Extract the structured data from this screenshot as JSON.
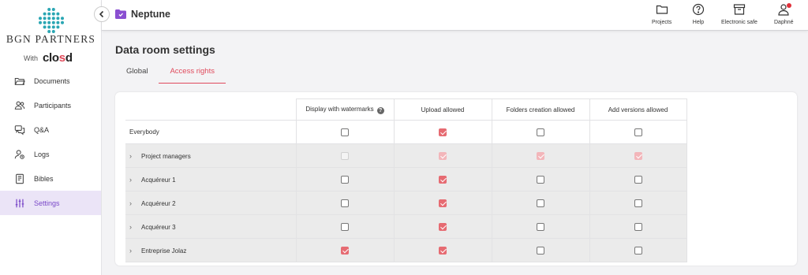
{
  "brand": {
    "name": "BGN PARTNERS",
    "with_label": "With",
    "partner_prefix": "clo",
    "partner_accent": "s",
    "partner_suffix": "d"
  },
  "sidebar": {
    "items": [
      {
        "label": "Documents",
        "icon": "folder-open-icon"
      },
      {
        "label": "Participants",
        "icon": "users-icon"
      },
      {
        "label": "Q&A",
        "icon": "chat-icon"
      },
      {
        "label": "Logs",
        "icon": "user-log-icon"
      },
      {
        "label": "Bibles",
        "icon": "book-icon"
      },
      {
        "label": "Settings",
        "icon": "sliders-icon",
        "active": true
      }
    ]
  },
  "header": {
    "project_title": "Neptune",
    "actions": [
      {
        "label": "Projects",
        "icon": "folder-icon"
      },
      {
        "label": "Help",
        "icon": "help-icon"
      },
      {
        "label": "Electronic safe",
        "icon": "archive-icon"
      },
      {
        "label": "Daphné",
        "icon": "user-icon",
        "notification": true
      }
    ]
  },
  "page": {
    "title": "Data room settings",
    "tabs": [
      {
        "label": "Global",
        "active": false
      },
      {
        "label": "Access rights",
        "active": true
      }
    ]
  },
  "permissions": {
    "columns": [
      "Display with watermarks",
      "Upload allowed",
      "Folders creation allowed",
      "Add versions allowed"
    ],
    "rows": [
      {
        "name": "Everybody",
        "expandable": false,
        "group": false,
        "disabled": false,
        "values": [
          false,
          true,
          false,
          false
        ]
      },
      {
        "name": "Project managers",
        "expandable": true,
        "group": true,
        "disabled": true,
        "values": [
          false,
          true,
          true,
          true
        ]
      },
      {
        "name": "Acquéreur 1",
        "expandable": true,
        "group": true,
        "disabled": false,
        "values": [
          false,
          true,
          false,
          false
        ]
      },
      {
        "name": "Acquéreur 2",
        "expandable": true,
        "group": true,
        "disabled": false,
        "values": [
          false,
          true,
          false,
          false
        ]
      },
      {
        "name": "Acquéreur 3",
        "expandable": true,
        "group": true,
        "disabled": false,
        "values": [
          false,
          true,
          false,
          false
        ]
      },
      {
        "name": "Entreprise Jolaz",
        "expandable": true,
        "group": true,
        "disabled": false,
        "values": [
          true,
          true,
          false,
          false
        ]
      }
    ]
  },
  "colors": {
    "accent": "#e04a5c",
    "checkbox_checked": "#e66b72",
    "active_nav": "#7a48c8",
    "logo": "#2aa6b3"
  }
}
